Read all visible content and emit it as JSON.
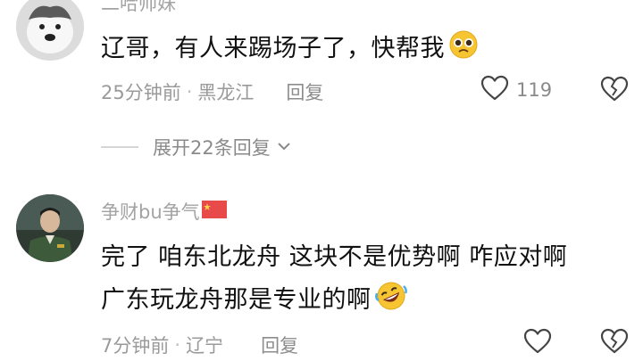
{
  "comment1": {
    "username": "二哈帅妹",
    "text": "辽哥，有人来踢场子了，快帮我",
    "time": "25分钟前",
    "location": "黑龙江",
    "reply_label": "回复",
    "like_count": "119",
    "emoji_icon": "pleading-face-emoji"
  },
  "expand_replies": {
    "label": "展开22条回复"
  },
  "comment2": {
    "username": "争财bu争气",
    "text_line1": "完了 咱东北龙舟 这块不是优势啊 咋应对啊",
    "text_line2": "广东玩龙舟那是专业的啊",
    "time": "7分钟前",
    "location": "辽宁",
    "reply_label": "回复",
    "emoji_icon": "rolling-on-floor-laughing-emoji",
    "flag_icon": "china-flag-icon"
  }
}
